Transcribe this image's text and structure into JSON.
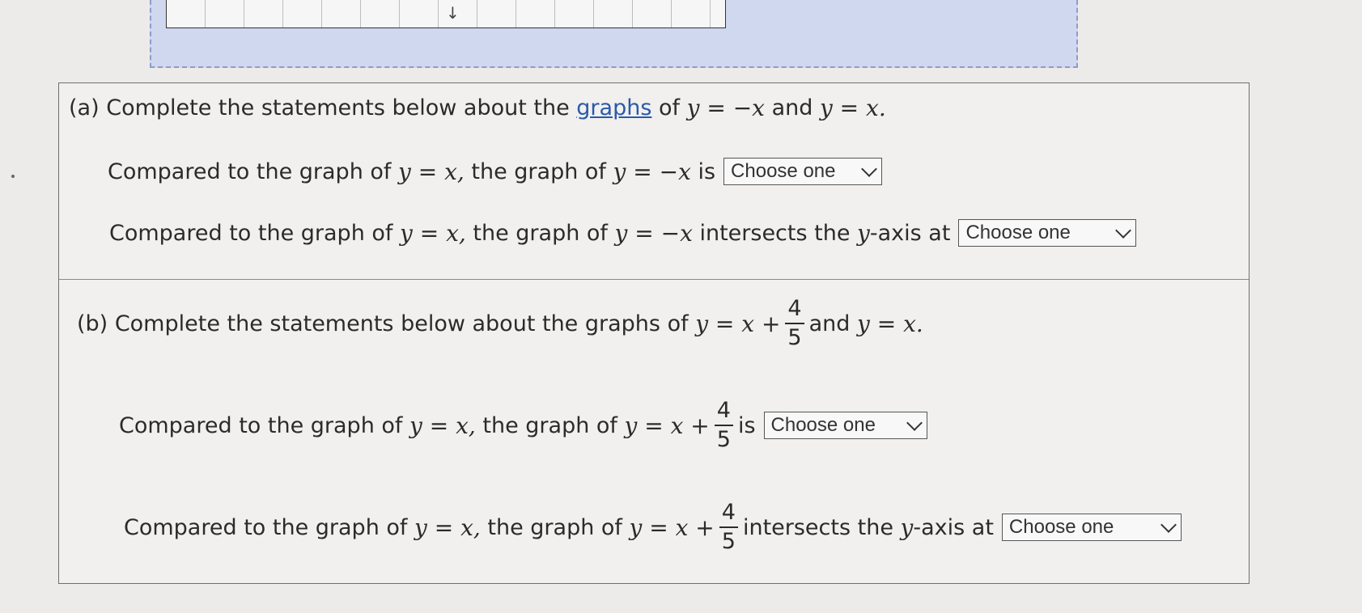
{
  "part_a": {
    "label": "(a)",
    "intro_text": "Complete the statements below about the",
    "link_text": "graphs",
    "of": "of",
    "eq_neg": "y = −x",
    "and": "and",
    "eq_base": "y = x.",
    "s1": {
      "prefix": "Compared to the graph of",
      "eq_base": "y = x,",
      "mid": "the graph of",
      "eq": "y = −x",
      "suffix": "is",
      "select_value": "Choose one"
    },
    "s2": {
      "prefix": "Compared to the graph of",
      "eq_base": "y = x,",
      "mid": "the graph of",
      "eq": "y = −x",
      "suffix_a": "intersects the",
      "axis_var": "y",
      "suffix_b": "-axis at",
      "select_value": "Choose one"
    }
  },
  "part_b": {
    "label": "(b)",
    "intro_text": "Complete the statements below about the graphs of",
    "eq_shift": "y = x +",
    "frac_num": "4",
    "frac_den": "5",
    "and": "and",
    "eq_base": "y = x.",
    "s1": {
      "prefix": "Compared to the graph of",
      "eq_base": "y = x,",
      "mid": "the graph of",
      "eq": "y = x +",
      "frac_num": "4",
      "frac_den": "5",
      "suffix": "is",
      "select_value": "Choose one"
    },
    "s2": {
      "prefix": "Compared to the graph of",
      "eq_base": "y = x,",
      "mid": "the graph of",
      "eq": "y = x +",
      "frac_num": "4",
      "frac_den": "5",
      "suffix_a": "intersects the",
      "axis_var": "y",
      "suffix_b": "-axis at",
      "select_value": "Choose one"
    }
  },
  "icons": {
    "dropdown": "chevron-down-icon",
    "graph_arrow": "arrow-down-icon"
  }
}
